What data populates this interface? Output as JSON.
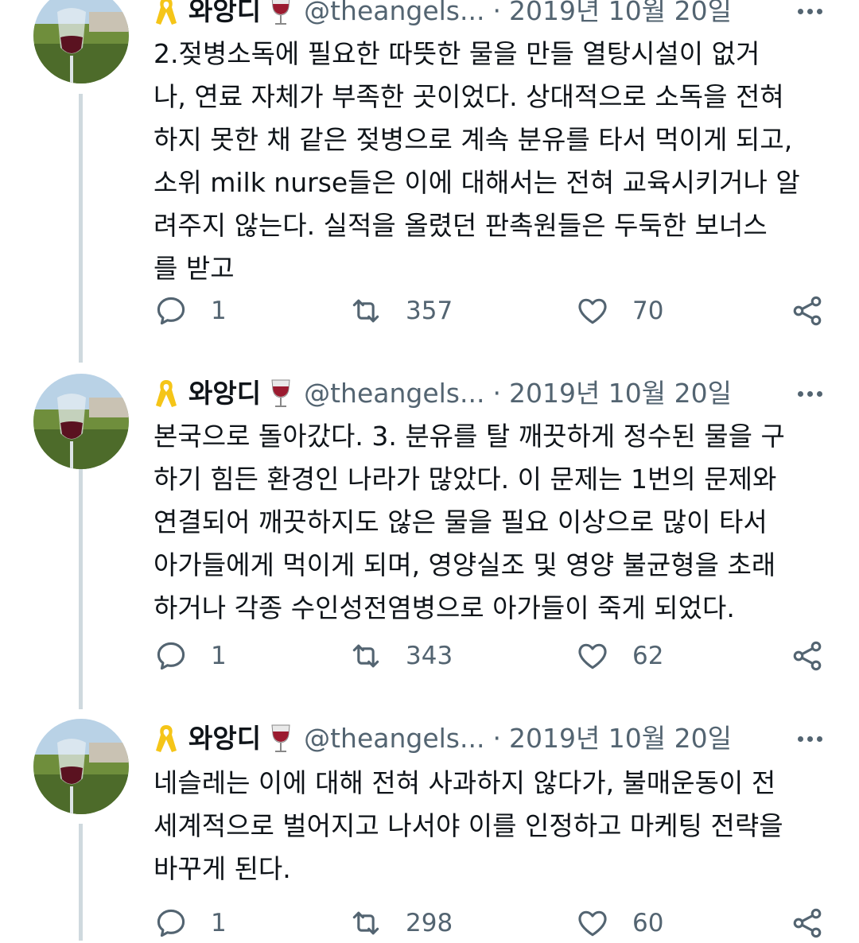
{
  "tweets": [
    {
      "name": "와앙디",
      "handle": "@theangels...",
      "separator": "·",
      "date": "2019년 10월 20일",
      "text": "2.젖병소독에 필요한 따뜻한 물을 만들 열탕시설이 없거\n나, 연료 자체가 부족한 곳이었다. 상대적으로 소독을 전혀\n하지 못한 채 같은 젖병으로 계속 분유를 타서 먹이게 되고,\n소위 milk nurse들은 이에 대해서는 전혀 교육시키거나 알\n려주지 않는다. 실적을 올렸던 판촉원들은 두둑한 보너스\n를 받고",
      "replies": "1",
      "retweets": "357",
      "likes": "70"
    },
    {
      "name": "와앙디",
      "handle": "@theangels...",
      "separator": "·",
      "date": "2019년 10월 20일",
      "text": "본국으로 돌아갔다. 3. 분유를 탈 깨끗하게 정수된 물을 구\n하기 힘든 환경인 나라가 많았다. 이 문제는 1번의 문제와\n연결되어 깨끗하지도 않은 물을 필요 이상으로 많이 타서\n아가들에게 먹이게 되며, 영양실조 및 영양 불균형을 초래\n하거나 각종 수인성전염병으로 아가들이 죽게 되었다.",
      "replies": "1",
      "retweets": "343",
      "likes": "62"
    },
    {
      "name": "와앙디",
      "handle": "@theangels...",
      "separator": "·",
      "date": "2019년 10월 20일",
      "text": "네슬레는 이에 대해 전혀 사과하지 않다가, 불매운동이 전\n세계적으로 벌어지고 나서야 이를 인정하고 마케팅 전략을\n바꾸게 된다.",
      "replies": "1",
      "retweets": "298",
      "likes": "60"
    }
  ],
  "colors": {
    "text": "#0f1419",
    "muted": "#536471",
    "thread_line": "#cfd9de",
    "ribbon": "#f5c518",
    "wine": "#9b1b30"
  },
  "icons": [
    "yellow-ribbon-icon",
    "wine-glass-icon",
    "more-icon",
    "reply-icon",
    "retweet-icon",
    "like-icon",
    "share-icon"
  ]
}
